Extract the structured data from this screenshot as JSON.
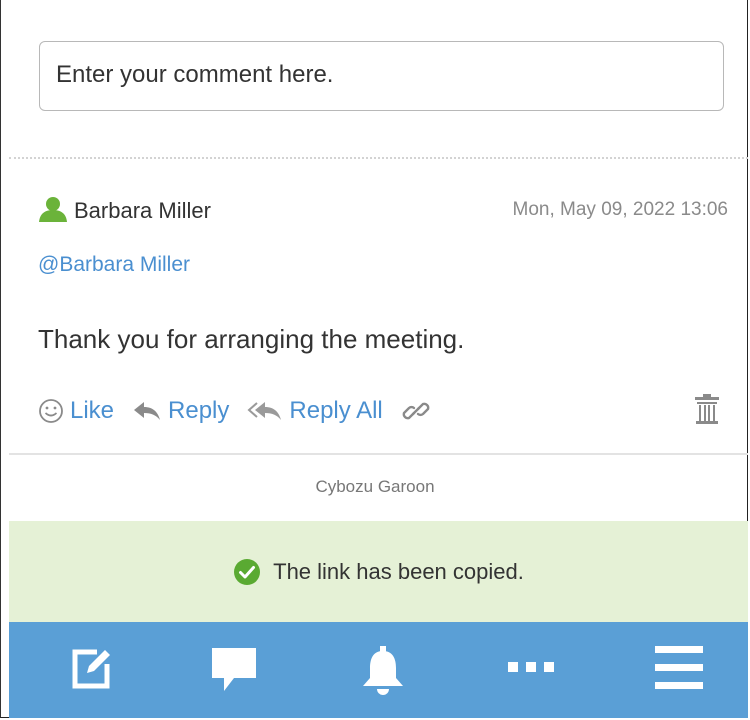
{
  "comment_input": {
    "placeholder": "Enter your comment here."
  },
  "comment": {
    "author": "Barbara Miller",
    "timestamp": "Mon, May 09, 2022 13:06",
    "mention": "@Barbara Miller",
    "body": "Thank you for arranging the meeting.",
    "actions": {
      "like": "Like",
      "reply": "Reply",
      "reply_all": "Reply All"
    }
  },
  "footer": {
    "brand": "Cybozu Garoon"
  },
  "toast": {
    "message": "The link has been copied."
  },
  "bottom_nav": {
    "items": [
      {
        "icon": "compose-icon"
      },
      {
        "icon": "comment-icon"
      },
      {
        "icon": "bell-icon"
      },
      {
        "icon": "more-icon"
      },
      {
        "icon": "menu-icon"
      }
    ]
  },
  "colors": {
    "link": "#4a8fd0",
    "toast_bg": "#e5f1d6",
    "nav_bg": "#5a9fd6",
    "success": "#5aaa32",
    "user_icon": "#6bb33a"
  }
}
